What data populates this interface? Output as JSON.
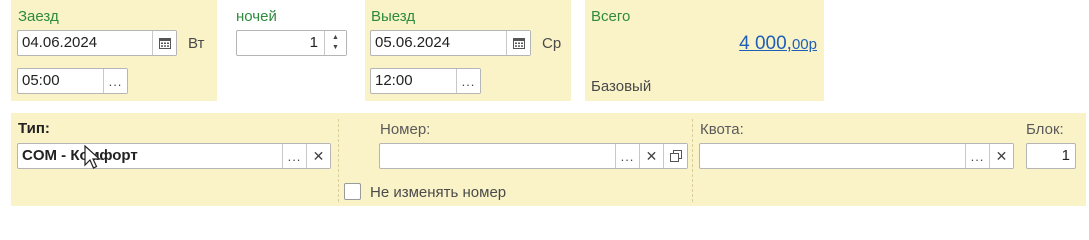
{
  "checkin": {
    "label": "Заезд",
    "date": "04.06.2024",
    "weekday": "Вт",
    "time": "05:00"
  },
  "nights": {
    "label": "ночей",
    "value": "1"
  },
  "checkout": {
    "label": "Выезд",
    "date": "05.06.2024",
    "weekday": "Ср",
    "time": "12:00"
  },
  "total": {
    "label": "Всего",
    "amount_main": "4 000,",
    "amount_cents": "00р",
    "rate_label": "Базовый"
  },
  "room": {
    "type_label": "Тип:",
    "type_value": "COM - Комфорт",
    "number_label": "Номер:",
    "number_value": "",
    "quota_label": "Квота:",
    "quota_value": "",
    "block_label": "Блок:",
    "block_value": "1",
    "keep_number_label": "Не изменять номер",
    "keep_number_checked": false
  },
  "colors": {
    "panel": "#faf3c8",
    "label_green": "#2e8b3e",
    "link_blue": "#1f5fb7"
  },
  "icons": [
    "calendar-icon",
    "ellipsis-icon",
    "spin-up-icon",
    "spin-down-icon",
    "clear-icon",
    "open-icon",
    "checkbox-icon",
    "mouse-cursor-icon"
  ]
}
